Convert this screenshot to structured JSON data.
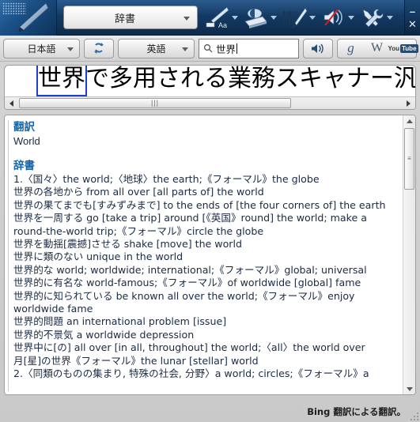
{
  "window": {
    "app_mode_label": "辞書",
    "minimize_label": "–",
    "close_label": "✕"
  },
  "toolbar": {
    "items": [
      {
        "name": "ocr-text-tool",
        "label": "Aa"
      },
      {
        "name": "scanner-tool",
        "label": ""
      },
      {
        "name": "barcode-tool",
        "label": ""
      },
      {
        "name": "mute-audio-tool",
        "label": ""
      },
      {
        "name": "settings-tool",
        "label": ""
      }
    ]
  },
  "langbar": {
    "source_language": "日本語",
    "swap_label": "",
    "target_language": "英語",
    "search_value": "世界",
    "search_placeholder": "",
    "speak_label": "",
    "links": [
      {
        "name": "google-link",
        "label": "g"
      },
      {
        "name": "wikipedia-link",
        "label": "W"
      },
      {
        "name": "youtube-link",
        "label_1": "You",
        "label_2": "Tube"
      }
    ]
  },
  "ocr": {
    "highlight": "世界",
    "rest": "で多用される業務スキャナー汎"
  },
  "results": {
    "translation_heading": "翻訳",
    "translation_value": "World",
    "dictionary_heading": "辞書",
    "entries": [
      "1.〈国々〉the world;〈地球〉the earth;《フォーマル》the globe",
      "世界の各地から from all over [all parts of] the world",
      "世界の果てまでも[すみずみまで] to the ends of [the four corners of] the earth",
      "世界を一周する go [take a trip] around [《英国》round] the world; make a round-the-world trip;《フォーマル》circle the globe",
      "世界を動揺[震撼]させる shake [move] the world",
      "世界に類のない unique in the world",
      "世界的な world; worldwide; international;《フォーマル》global; universal",
      "世界的に有名な world-famous;《フォーマル》of worldwide [global] fame",
      "世界的に知られている be known all over the world;《フォーマル》enjoy worldwide fame",
      "世界的問題 an international problem [issue]",
      "世界的不景気 a worldwide depression",
      "世界中に[の] all over [in all, throughout] the world;〈all〉the world over",
      "月[星]の世界《フォーマル》the lunar [stellar] world",
      "2.〈同類のものの集まり, 特殊の社会, 分野〉a world; circles;《フォーマル》a"
    ]
  },
  "statusbar": {
    "attribution": "Bing 翻訳による翻訳。"
  },
  "colors": {
    "titlebar_blue": "#143a63",
    "heading_blue": "#1763a8",
    "body_navy": "#1b2a44",
    "highlight_border": "#1b3fd0",
    "youtube_badge": "#2b4a72"
  }
}
